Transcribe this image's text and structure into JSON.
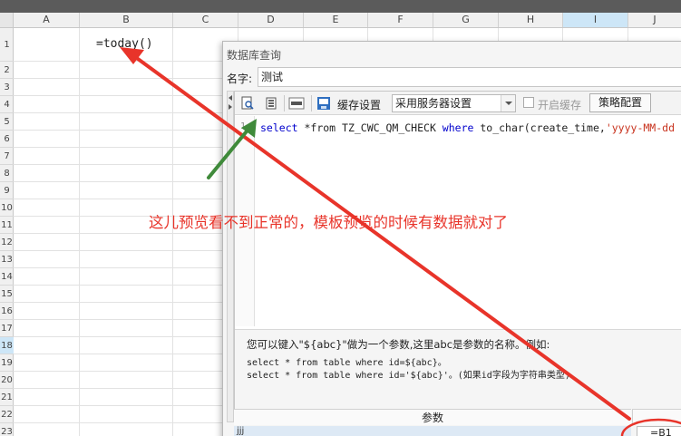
{
  "spreadsheet": {
    "columns": [
      "A",
      "B",
      "C",
      "D",
      "E",
      "F",
      "G",
      "H",
      "I",
      "J"
    ],
    "selected_column": "I",
    "rows": [
      "1",
      "2",
      "3",
      "4",
      "5",
      "6",
      "7",
      "8",
      "9",
      "10",
      "11",
      "12",
      "13",
      "14",
      "15",
      "16",
      "17",
      "18",
      "19",
      "20",
      "21",
      "22",
      "23"
    ],
    "selected_row": "18",
    "cell_b1_formula": "=today()"
  },
  "dialog": {
    "title": "数据库查询",
    "name_label": "名字:",
    "name_value": "测试",
    "toolbar": {
      "cache_settings_label": "缓存设置",
      "cache_select_value": "采用服务器设置",
      "enable_cache_label": "开启缓存",
      "strategy_button": "策略配置"
    },
    "editor": {
      "line_number": "1",
      "code_parts": {
        "select": "select",
        "star_from": " *from ",
        "table": "TZ_CWC_QM_CHECK",
        "where": " where ",
        "func": "to_char(create_time,",
        "str": "'yyyy-MM-dd"
      }
    },
    "hint": {
      "line1": "您可以键入\"${abc}\"做为一个参数,这里abc是参数的名称。例如:",
      "line2": "select * from table where id=${abc}。",
      "line3": "select * from table where id='${abc}'。(如果id字段为字符串类型)"
    },
    "params": {
      "header": "参数",
      "row_name": "jjj",
      "row_value": "=B1"
    }
  },
  "annotation": {
    "text": "这儿预览看不到正常的，模板预览的时候有数据就对了",
    "color": "#e8342a",
    "arrow_green": "#3f8a3a"
  }
}
